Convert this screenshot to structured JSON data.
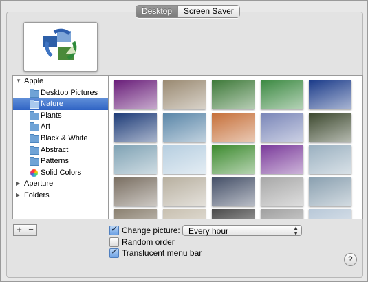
{
  "tabs": [
    {
      "label": "Desktop",
      "active": true
    },
    {
      "label": "Screen Saver",
      "active": false
    }
  ],
  "preview": {
    "icon": "image-rotation-icon"
  },
  "source_list": [
    {
      "type": "group",
      "label": "Apple",
      "expanded": true
    },
    {
      "type": "child",
      "label": "Desktop Pictures",
      "icon": "folder-icon",
      "selected": false
    },
    {
      "type": "child",
      "label": "Nature",
      "icon": "folder-icon",
      "selected": true
    },
    {
      "type": "child",
      "label": "Plants",
      "icon": "folder-icon",
      "selected": false
    },
    {
      "type": "child",
      "label": "Art",
      "icon": "folder-icon",
      "selected": false
    },
    {
      "type": "child",
      "label": "Black & White",
      "icon": "folder-icon",
      "selected": false
    },
    {
      "type": "child",
      "label": "Abstract",
      "icon": "folder-icon",
      "selected": false
    },
    {
      "type": "child",
      "label": "Patterns",
      "icon": "folder-icon",
      "selected": false
    },
    {
      "type": "child",
      "label": "Solid Colors",
      "icon": "color-wheel-icon",
      "selected": false
    },
    {
      "type": "group",
      "label": "Aperture",
      "expanded": false
    },
    {
      "type": "group",
      "label": "Folders",
      "expanded": false
    }
  ],
  "thumbnails": [
    [
      "#6a1f7a",
      "#9a8a72",
      "#3f7a3a",
      "#3d8a43",
      "#1c3c8a"
    ],
    [
      "#1e3c78",
      "#5a86a8",
      "#c6703a",
      "#7a86b8",
      "#3e4a30"
    ],
    [
      "#7fa2b4",
      "#b6cee0",
      "#3c8a2e",
      "#7a3a9a",
      "#9ab0c0"
    ],
    [
      "#7a6f62",
      "#b8b0a0",
      "#455068",
      "#a8a8a8",
      "#8aa0b0"
    ],
    [
      "#8a8070",
      "#c8c0b0",
      "#4a4a4a",
      "#a0a0a0",
      "#b8c8d8"
    ]
  ],
  "buttons": {
    "add": "+",
    "remove": "−",
    "help": "?"
  },
  "options": {
    "change_picture": {
      "label": "Change picture:",
      "checked": true
    },
    "interval": "Every hour",
    "random_order": {
      "label": "Random order",
      "checked": false
    },
    "translucent": {
      "label": "Translucent menu bar",
      "checked": true
    }
  }
}
